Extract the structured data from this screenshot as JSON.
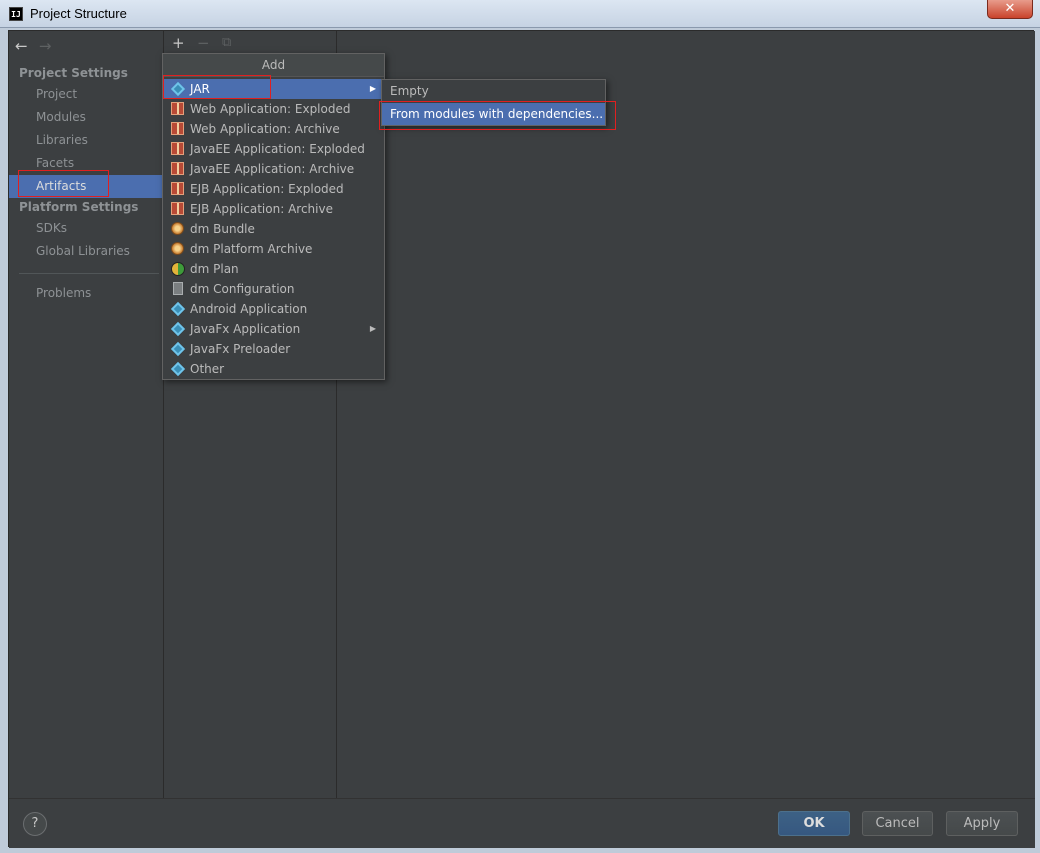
{
  "window": {
    "title": "Project Structure",
    "app_icon": "IJ",
    "close_glyph": "✕"
  },
  "nav": {
    "back_glyph": "←",
    "forward_glyph": "→",
    "project_settings": "Project Settings",
    "items_project": [
      "Project",
      "Modules",
      "Libraries",
      "Facets",
      "Artifacts"
    ],
    "platform_settings": "Platform Settings",
    "items_platform": [
      "SDKs",
      "Global Libraries"
    ],
    "problems": "Problems",
    "selected": "Artifacts"
  },
  "toolbar": {
    "add_glyph": "+",
    "remove_glyph": "−",
    "copy_glyph": "⧉"
  },
  "popup": {
    "header": "Add",
    "items": [
      {
        "label": "JAR",
        "icon": "jar-icon",
        "submenu": true
      },
      {
        "label": "Web Application: Exploded",
        "icon": "web-exploded-icon"
      },
      {
        "label": "Web Application: Archive",
        "icon": "web-archive-icon"
      },
      {
        "label": "JavaEE Application: Exploded",
        "icon": "javaee-exploded-icon"
      },
      {
        "label": "JavaEE Application: Archive",
        "icon": "javaee-archive-icon"
      },
      {
        "label": "EJB Application: Exploded",
        "icon": "ejb-exploded-icon"
      },
      {
        "label": "EJB Application: Archive",
        "icon": "ejb-archive-icon"
      },
      {
        "label": "dm Bundle",
        "icon": "dm-bundle-icon"
      },
      {
        "label": "dm Platform Archive",
        "icon": "dm-platform-icon"
      },
      {
        "label": "dm Plan",
        "icon": "dm-plan-icon"
      },
      {
        "label": "dm Configuration",
        "icon": "dm-config-icon"
      },
      {
        "label": "Android Application",
        "icon": "android-icon"
      },
      {
        "label": "JavaFx Application",
        "icon": "javafx-app-icon",
        "submenu": true
      },
      {
        "label": "JavaFx Preloader",
        "icon": "javafx-preloader-icon"
      },
      {
        "label": "Other",
        "icon": "other-icon"
      }
    ],
    "arrow_glyph": "▶"
  },
  "submenu": {
    "items": [
      "Empty",
      "From modules with dependencies..."
    ]
  },
  "buttons": {
    "help": "?",
    "ok": "OK",
    "cancel": "Cancel",
    "apply": "Apply"
  },
  "colors": {
    "background": "#3c3f41",
    "selection": "#4b6eaf",
    "annotation": "#e02020"
  }
}
